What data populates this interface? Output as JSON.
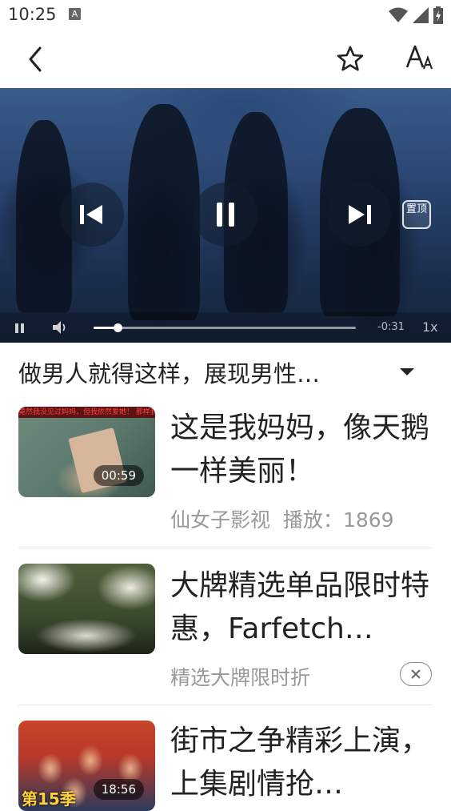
{
  "status_bar": {
    "time": "10:25",
    "notification_icon": "A"
  },
  "top_bar": {
    "back_icon": "chevron-left-icon",
    "favorite_icon": "star-icon",
    "font_icon": "font-size-icon"
  },
  "video": {
    "pin_label": "置顶",
    "remaining_time": "-0:31",
    "speed": "1x",
    "progress": 0.09
  },
  "title_row": {
    "title": "做男人就得这样，展现男性…"
  },
  "list": {
    "items": [
      {
        "title": "这是我妈妈，像天鹅一样美丽！",
        "duration": "00:59",
        "source": "仙女子影视",
        "plays_label": "播放：",
        "plays": "1869",
        "banner": "竟然我没见过妈妈，但我依然爱她！ 那样我演出了！"
      },
      {
        "title": "大牌精选单品限时特惠，Farfetch…",
        "ad_text": "精选大牌限时折"
      },
      {
        "title": "街市之争精彩上演，上集剧情抢…",
        "duration": "18:56",
        "season": "第15季"
      }
    ]
  }
}
